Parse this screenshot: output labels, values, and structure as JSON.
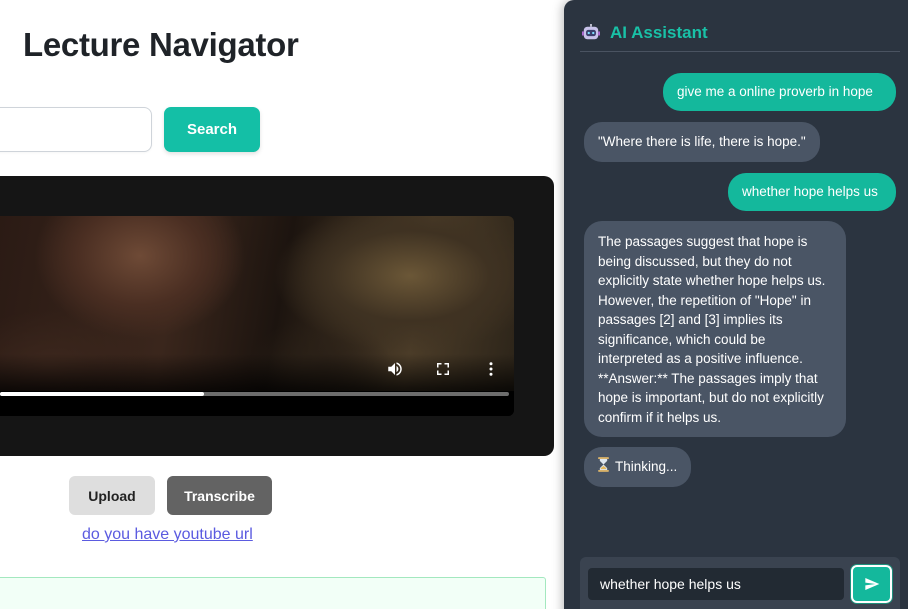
{
  "app": {
    "title": "Lecture Navigator"
  },
  "search": {
    "value": "",
    "button_label": "Search"
  },
  "video": {
    "progress_fraction": 0.4,
    "icons": [
      "volume-icon",
      "fullscreen-icon",
      "more-options-icon"
    ]
  },
  "actions": {
    "upload_label": "Upload",
    "transcribe_label": "Transcribe",
    "youtube_link": "do you have youtube url"
  },
  "assistant": {
    "title": "AI Assistant",
    "messages": [
      {
        "role": "user",
        "text": "give me a online proverb in hope"
      },
      {
        "role": "bot",
        "text": "\"Where there is life, there is hope.\""
      },
      {
        "role": "user",
        "text": "whether hope helps us"
      },
      {
        "role": "bot",
        "text": "The passages suggest that hope is being discussed, but they do not explicitly state whether hope helps us. However, the repetition of \"Hope\" in passages [2] and [3] implies its significance, which could be interpreted as a positive influence. **Answer:** The passages imply that hope is important, but do not explicitly confirm if it helps us."
      },
      {
        "role": "bot",
        "text": "Thinking...",
        "icon": "hourglass-icon"
      }
    ],
    "input_value": "whether hope helps us"
  },
  "colors": {
    "accent": "#14bfa6",
    "panel_bg": "#2b3440",
    "bot_bubble": "#4a5565",
    "link": "#5b5be0"
  }
}
